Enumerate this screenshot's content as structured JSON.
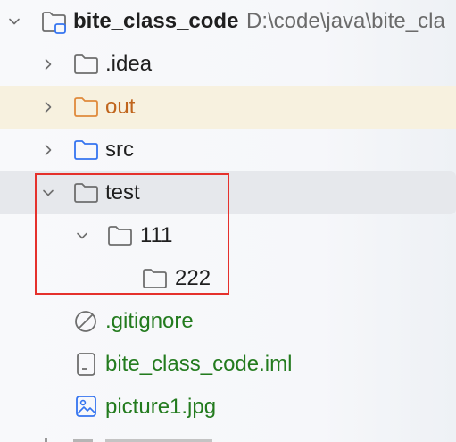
{
  "root": {
    "name": "bite_class_code",
    "path": "D:\\code\\java\\bite_cla",
    "icon": "module-folder-icon"
  },
  "items": [
    {
      "label": ".idea",
      "icon": "folder-icon",
      "expanded": false
    },
    {
      "label": "out",
      "icon": "folder-icon",
      "expanded": false
    },
    {
      "label": "src",
      "icon": "folder-icon",
      "expanded": false
    },
    {
      "label": "test",
      "icon": "folder-icon",
      "expanded": true
    },
    {
      "label": "111",
      "icon": "folder-icon",
      "expanded": true
    },
    {
      "label": "222",
      "icon": "folder-icon"
    },
    {
      "label": ".gitignore",
      "icon": "ignore-file-icon"
    },
    {
      "label": "bite_class_code.iml",
      "icon": "iml-file-icon"
    },
    {
      "label": "picture1.jpg",
      "icon": "image-file-icon"
    }
  ],
  "colors": {
    "excluded": "#c0651d",
    "untracked": "#237b1e",
    "highlight_box": "#e5312c",
    "source_folder": "#3574f0"
  }
}
